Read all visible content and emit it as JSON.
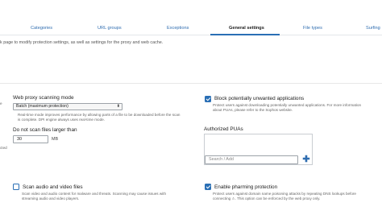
{
  "tabs": [
    {
      "label": "Categories"
    },
    {
      "label": "URL groups"
    },
    {
      "label": "Exceptions"
    },
    {
      "label": "General settings"
    },
    {
      "label": "File types"
    },
    {
      "label": "Surfing"
    }
  ],
  "page_description": "k page to modify protection settings, as well as settings for the proxy and web cache.",
  "scanning": {
    "title": "Web proxy scanning mode",
    "selected": "Batch (maximum protection)",
    "help_line1": "Real-time mode improves performance by allowing parts of a file to be downloaded before the scan",
    "help_line2": "is complete. DPI engine always uses real-time mode."
  },
  "file_size": {
    "title": "Do not scan files larger than",
    "value": "30",
    "unit": "MB"
  },
  "edge_labels": {
    "left": "e",
    "cted": "cted"
  },
  "pua": {
    "checkbox_label": "Block potentially unwanted applications",
    "help_line1": "Protect users against downloading potentially unwanted applications. For more information",
    "help_line2": "about PUAs, please refer to the Sophos website.",
    "authorized_title": "Authorized PUAs",
    "search_placeholder": "Search / Add",
    "add_symbol": "✚"
  },
  "audio_video": {
    "checkbox_label": "Scan audio and video files",
    "help_line1": "Scan video and audio content for malware and threats. Scanning may cause issues with",
    "help_line2": "streaming audio and video players."
  },
  "pharming": {
    "checkbox_label": "Enable pharming protection",
    "help_line1": "Protect users against domain name poisoning attacks by repeating DNS lookups before",
    "help_line2": "connecting ⚠. This option can be enforced by the web proxy only."
  },
  "colors": {
    "accent": "#2a6fb5",
    "link": "#2f6db0"
  }
}
